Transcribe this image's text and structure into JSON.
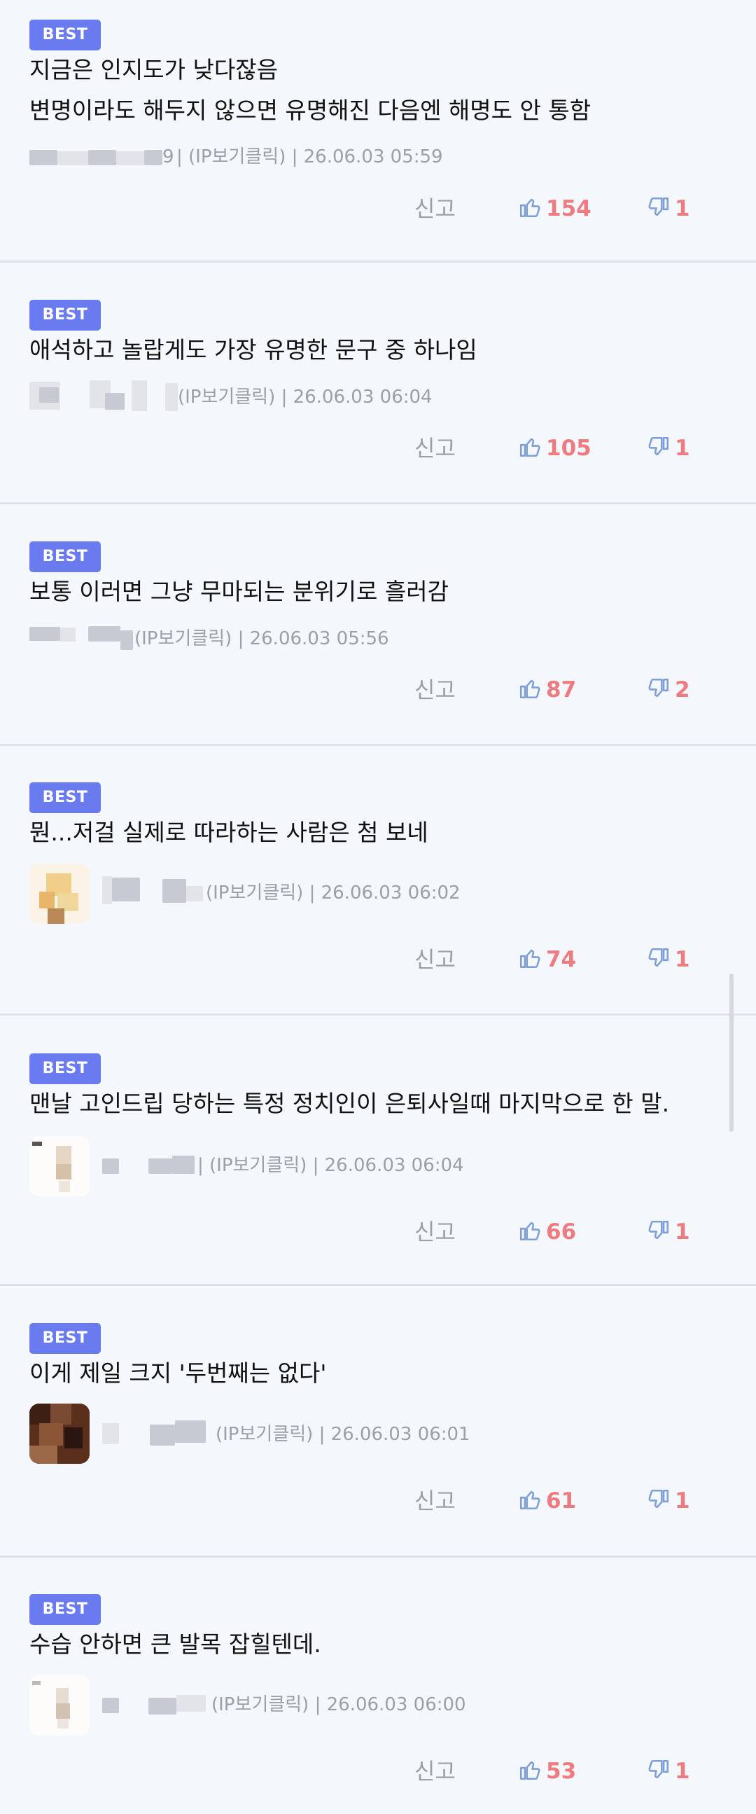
{
  "comments": [
    {
      "badge": "BEST",
      "lines": [
        "지금은 인지도가 낮다잖음",
        "변명이라도 해두지 않으면 유명해진 다음엔 해명도 안 통함"
      ],
      "author_tail": "9",
      "meta": "| (IP보기클릭) | 26.06.03 05:59",
      "report": "신고",
      "likes": "154",
      "dislikes": "1"
    },
    {
      "badge": "BEST",
      "lines": [
        "애석하고 놀랍게도 가장 유명한 문구 중 하나임"
      ],
      "author_tail": "",
      "meta": "(IP보기클릭) | 26.06.03 06:04",
      "report": "신고",
      "likes": "105",
      "dislikes": "1"
    },
    {
      "badge": "BEST",
      "lines": [
        "보통 이러면 그냥 무마되는 분위기로 흘러감"
      ],
      "author_tail": "",
      "meta": "(IP보기클릭) | 26.06.03 05:56",
      "report": "신고",
      "likes": "87",
      "dislikes": "2"
    },
    {
      "badge": "BEST",
      "lines": [
        "뭔...저걸 실제로 따라하는 사람은 첨 보네"
      ],
      "author_tail": "",
      "meta": "(IP보기클릭) | 26.06.03 06:02",
      "report": "신고",
      "likes": "74",
      "dislikes": "1"
    },
    {
      "badge": "BEST",
      "lines": [
        "맨날 고인드립 당하는 특정 정치인이 은퇴사일때 마지막으로 한 말."
      ],
      "author_tail": "",
      "meta": "| (IP보기클릭) | 26.06.03 06:04",
      "report": "신고",
      "likes": "66",
      "dislikes": "1"
    },
    {
      "badge": "BEST",
      "lines": [
        "이게 제일 크지 '두번째는 없다'"
      ],
      "author_tail": "",
      "meta": "(IP보기클릭) | 26.06.03 06:01",
      "report": "신고",
      "likes": "61",
      "dislikes": "1"
    },
    {
      "badge": "BEST",
      "lines": [
        "수습 안하면 큰 발목 잡힐텐데."
      ],
      "author_tail": "",
      "meta": "(IP보기클릭) | 26.06.03 06:00",
      "report": "신고",
      "likes": "53",
      "dislikes": "1"
    }
  ],
  "colors": {
    "background": "#f4f7fc",
    "badge": "#6a7bf0",
    "count": "#ee7b80",
    "thumb_up": "#7e9fd6",
    "thumb_down": "#7e9fd6",
    "meta": "#9a9fa8"
  },
  "icons": {
    "like": "thumbs-up-icon",
    "dislike": "thumbs-down-icon"
  }
}
